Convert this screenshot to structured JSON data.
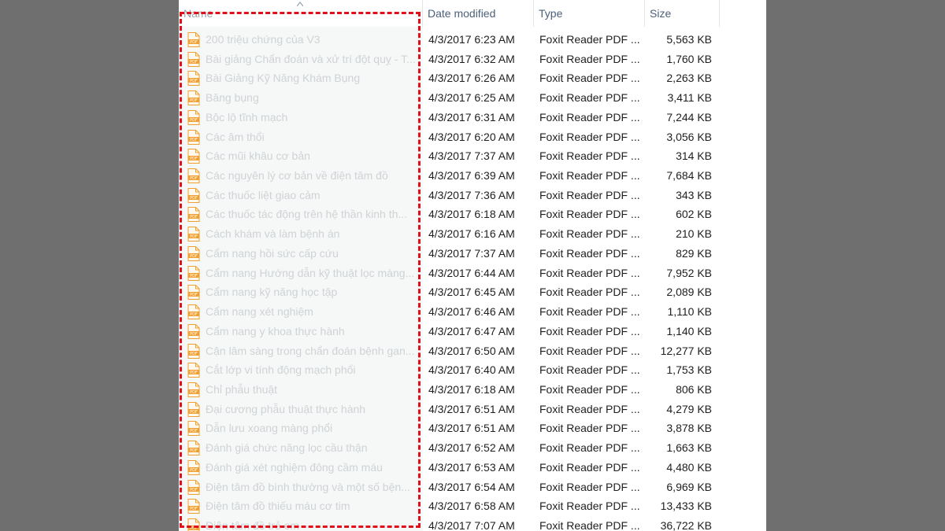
{
  "header": {
    "name_label": "Name",
    "date_label": "Date modified",
    "type_label": "Type",
    "size_label": "Size"
  },
  "files": [
    {
      "name": "200 triệu chứng của V3",
      "date": "4/3/2017 6:23 AM",
      "type": "Foxit Reader PDF ...",
      "size": "5,563 KB"
    },
    {
      "name": "Bài giảng Chẩn đoán và xử trí đột quỵ - T...",
      "date": "4/3/2017 6:32 AM",
      "type": "Foxit Reader PDF ...",
      "size": "1,760 KB"
    },
    {
      "name": "Bài Giảng Kỹ Năng Khám Bụng",
      "date": "4/3/2017 6:26 AM",
      "type": "Foxit Reader PDF ...",
      "size": "2,263 KB"
    },
    {
      "name": "Băng bụng",
      "date": "4/3/2017 6:25 AM",
      "type": "Foxit Reader PDF ...",
      "size": "3,411 KB"
    },
    {
      "name": "Bộc lộ tĩnh mạch",
      "date": "4/3/2017 6:31 AM",
      "type": "Foxit Reader PDF ...",
      "size": "7,244 KB"
    },
    {
      "name": "Các âm thổi",
      "date": "4/3/2017 6:20 AM",
      "type": "Foxit Reader PDF ...",
      "size": "3,056 KB"
    },
    {
      "name": "Các mũi khâu cơ bản",
      "date": "4/3/2017 7:37 AM",
      "type": "Foxit Reader PDF ...",
      "size": "314 KB"
    },
    {
      "name": "Các nguyên lý cơ bản về điện tâm đồ",
      "date": "4/3/2017 6:39 AM",
      "type": "Foxit Reader PDF ...",
      "size": "7,684 KB"
    },
    {
      "name": "Các thuốc liệt giao cảm",
      "date": "4/3/2017 7:36 AM",
      "type": "Foxit Reader PDF ...",
      "size": "343 KB"
    },
    {
      "name": "Các thuốc tác động trên hệ thần kinh th...",
      "date": "4/3/2017 6:18 AM",
      "type": "Foxit Reader PDF ...",
      "size": "602 KB"
    },
    {
      "name": "Cách khám và làm bệnh án",
      "date": "4/3/2017 6:16 AM",
      "type": "Foxit Reader PDF ...",
      "size": "210 KB"
    },
    {
      "name": "Cẩm nang hồi sức cấp cứu",
      "date": "4/3/2017 7:37 AM",
      "type": "Foxit Reader PDF ...",
      "size": "829 KB"
    },
    {
      "name": "Cẩm nang Hướng dẫn kỹ thuật lọc màng...",
      "date": "4/3/2017 6:44 AM",
      "type": "Foxit Reader PDF ...",
      "size": "7,952 KB"
    },
    {
      "name": "Cẩm nang kỹ năng học tập",
      "date": "4/3/2017 6:45 AM",
      "type": "Foxit Reader PDF ...",
      "size": "2,089 KB"
    },
    {
      "name": "Cẩm nang xét nghiệm",
      "date": "4/3/2017 6:46 AM",
      "type": "Foxit Reader PDF ...",
      "size": "1,110 KB"
    },
    {
      "name": "Cẩm nang y khoa thực hành",
      "date": "4/3/2017 6:47 AM",
      "type": "Foxit Reader PDF ...",
      "size": "1,140 KB"
    },
    {
      "name": "Cận lâm sàng trong chẩn đoán bệnh gan...",
      "date": "4/3/2017 6:50 AM",
      "type": "Foxit Reader PDF ...",
      "size": "12,277 KB"
    },
    {
      "name": "Cắt lớp vi tính động mạch phổi",
      "date": "4/3/2017 6:40 AM",
      "type": "Foxit Reader PDF ...",
      "size": "1,753 KB"
    },
    {
      "name": "Chỉ phẫu thuật",
      "date": "4/3/2017 6:18 AM",
      "type": "Foxit Reader PDF ...",
      "size": "806 KB"
    },
    {
      "name": "Đại cương phẫu thuật thực hành",
      "date": "4/3/2017 6:51 AM",
      "type": "Foxit Reader PDF ...",
      "size": "4,279 KB"
    },
    {
      "name": "Dẫn lưu xoang màng phổi",
      "date": "4/3/2017 6:51 AM",
      "type": "Foxit Reader PDF ...",
      "size": "3,878 KB"
    },
    {
      "name": "Đánh giá chức năng lọc cầu thận",
      "date": "4/3/2017 6:52 AM",
      "type": "Foxit Reader PDF ...",
      "size": "1,663 KB"
    },
    {
      "name": "Đánh giá xét nghiệm đông cầm máu",
      "date": "4/3/2017 6:53 AM",
      "type": "Foxit Reader PDF ...",
      "size": "4,480 KB"
    },
    {
      "name": "Điện tâm đồ bình thường và một số bện...",
      "date": "4/3/2017 6:54 AM",
      "type": "Foxit Reader PDF ...",
      "size": "6,969 KB"
    },
    {
      "name": "Điện tâm đồ thiếu máu cơ tim",
      "date": "4/3/2017 6:58 AM",
      "type": "Foxit Reader PDF ...",
      "size": "13,433 KB"
    },
    {
      "name": "Điện tâm đồ trẻ em",
      "date": "4/3/2017 7:07 AM",
      "type": "Foxit Reader PDF ...",
      "size": "36,722 KB"
    }
  ],
  "colors": {
    "highlight_border": "#e0101a",
    "pdf_icon": "#f0a030",
    "header_text": "#4c607a"
  },
  "icons": {
    "file": "pdf-file-icon",
    "sort": "sort-ascending-icon"
  }
}
